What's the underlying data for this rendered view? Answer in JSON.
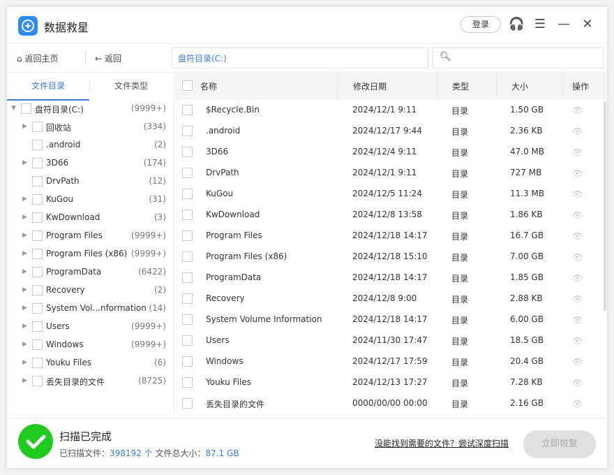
{
  "app": {
    "title": "数据救星",
    "login": "登录"
  },
  "toolbar": {
    "home": "返回主页",
    "back": "返回",
    "path": "盘符目录(C:)",
    "search_placeholder": ""
  },
  "tabs": [
    {
      "label": "文件目录",
      "active": true
    },
    {
      "label": "文件类型",
      "active": false
    }
  ],
  "tree": {
    "root": {
      "name": "盘符目录(C:)",
      "count": "(9999+)"
    },
    "items": [
      {
        "name": "回收站",
        "count": "(334)",
        "expandable": true
      },
      {
        "name": ".android",
        "count": "(2)",
        "expandable": false
      },
      {
        "name": "3D66",
        "count": "(174)",
        "expandable": true
      },
      {
        "name": "DrvPath",
        "count": "(12)",
        "expandable": false
      },
      {
        "name": "KuGou",
        "count": "(31)",
        "expandable": true
      },
      {
        "name": "KwDownload",
        "count": "(3)",
        "expandable": true
      },
      {
        "name": "Program Files",
        "count": "(9999+)",
        "expandable": true
      },
      {
        "name": "Program Files (x86)",
        "count": "(9999+)",
        "expandable": true
      },
      {
        "name": "ProgramData",
        "count": "(6422)",
        "expandable": true
      },
      {
        "name": "Recovery",
        "count": "(2)",
        "expandable": true
      },
      {
        "name": "System Vol...nformation",
        "count": "(14)",
        "expandable": true
      },
      {
        "name": "Users",
        "count": "(9999+)",
        "expandable": true
      },
      {
        "name": "Windows",
        "count": "(9999+)",
        "expandable": true
      },
      {
        "name": "Youku Files",
        "count": "(6)",
        "expandable": true
      },
      {
        "name": "丢失目录的文件",
        "count": "(8725)",
        "expandable": true
      }
    ]
  },
  "table": {
    "headers": {
      "name": "名称",
      "date": "修改日期",
      "type": "类型",
      "size": "大小",
      "action": "操作"
    },
    "rows": [
      {
        "name": "$Recycle.Bin",
        "date": "2024/12/1 9:11",
        "type": "目录",
        "size": "1.50 GB"
      },
      {
        "name": ".android",
        "date": "2024/12/17 9:44",
        "type": "目录",
        "size": "2.36 KB"
      },
      {
        "name": "3D66",
        "date": "2024/12/4 9:11",
        "type": "目录",
        "size": "47.0 MB"
      },
      {
        "name": "DrvPath",
        "date": "2024/12/1 9:11",
        "type": "目录",
        "size": "727 MB"
      },
      {
        "name": "KuGou",
        "date": "2024/12/5 11:24",
        "type": "目录",
        "size": "11.3 MB"
      },
      {
        "name": "KwDownload",
        "date": "2024/12/8 13:58",
        "type": "目录",
        "size": "1.86 KB"
      },
      {
        "name": "Program Files",
        "date": "2024/12/18 14:17",
        "type": "目录",
        "size": "16.7 GB"
      },
      {
        "name": "Program Files (x86)",
        "date": "2024/12/18 15:10",
        "type": "目录",
        "size": "7.00 GB"
      },
      {
        "name": "ProgramData",
        "date": "2024/12/18 14:17",
        "type": "目录",
        "size": "1.85 GB"
      },
      {
        "name": "Recovery",
        "date": "2024/12/8 9:00",
        "type": "目录",
        "size": "2.88 KB"
      },
      {
        "name": "System Volume Information",
        "date": "2024/12/18 14:17",
        "type": "目录",
        "size": "6.00 GB"
      },
      {
        "name": "Users",
        "date": "2024/11/30 17:47",
        "type": "目录",
        "size": "18.5 GB"
      },
      {
        "name": "Windows",
        "date": "2024/12/17 17:59",
        "type": "目录",
        "size": "20.4 GB"
      },
      {
        "name": "Youku Files",
        "date": "2024/12/13 17:27",
        "type": "目录",
        "size": "7.28 KB"
      },
      {
        "name": "丢失目录的文件",
        "date": "0000/00/00 00:00",
        "type": "目录",
        "size": "2.16 GB"
      }
    ]
  },
  "footer": {
    "status": "扫描已完成",
    "scanned_label": "已扫描文件：",
    "scanned_count": "398192 个",
    "size_label": "文件总大小：",
    "total_size": "87.1 GB",
    "deep_scan": "没能找到需要的文件？尝试深度扫描",
    "recover": "立即恢复"
  },
  "colors": {
    "accent": "#3a7de0",
    "success": "#1ecb1e",
    "logo": "#2f8cf5"
  }
}
